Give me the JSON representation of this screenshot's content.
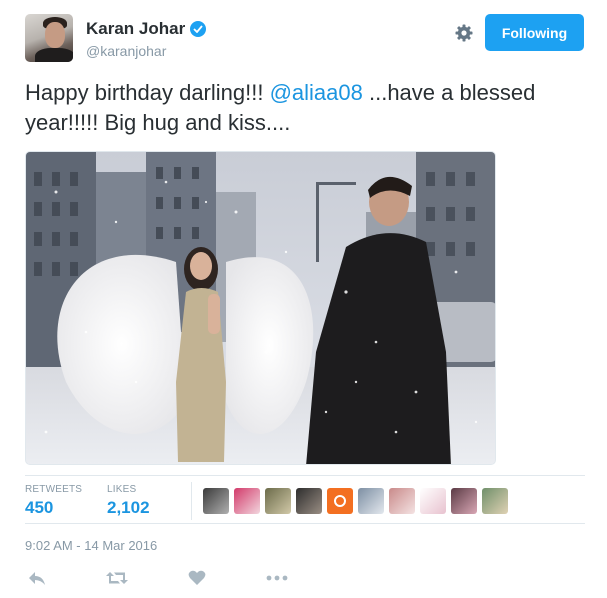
{
  "tweet": {
    "author": {
      "display_name": "Karan Johar",
      "handle": "@karanjohar",
      "verified": true
    },
    "follow_button_label": "Following",
    "text_parts": {
      "before": "Happy birthday darling!!! ",
      "mention": "@aliaa08",
      "after": " ...have a blessed year!!!!! Big hug and kiss...."
    },
    "stats": {
      "retweets_label": "RETWEETS",
      "retweets_value": "450",
      "likes_label": "LIKES",
      "likes_value": "2,102"
    },
    "timestamp": "9:02 AM - 14 Mar 2016"
  },
  "icons": {
    "verified": "verified-badge-icon",
    "gear": "gear-icon",
    "reply": "reply-icon",
    "retweet": "retweet-icon",
    "like": "heart-icon",
    "more": "more-dots-icon"
  },
  "colors": {
    "brand_blue": "#1da1f2",
    "mention_blue": "#1b95e0",
    "muted_gray": "#8899a6",
    "action_gray": "#aab8c2",
    "text": "#292f33"
  }
}
